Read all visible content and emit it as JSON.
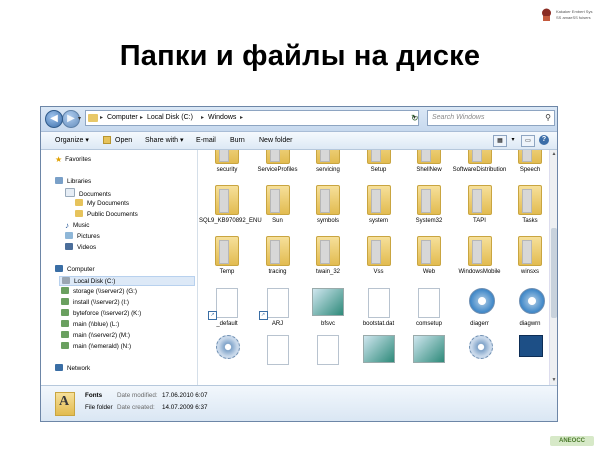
{
  "slide": {
    "title": "Папки и файлы на диске",
    "corner_logo": {
      "line1": "Kakaker Embert Sys",
      "line2": "SS amaeSS fuisers"
    },
    "bottom_logo": "ANEOCC"
  },
  "explorer": {
    "address": {
      "crumbs": [
        "Computer",
        "Local Disk (C:)",
        "Windows"
      ]
    },
    "search_placeholder": "Search Windows",
    "toolbar": {
      "organize": "Organize ▾",
      "open": "Open",
      "share": "Share with ▾",
      "email": "E-mail",
      "burn": "Burn",
      "new_folder": "New folder"
    },
    "nav": {
      "favorites": "Favorites",
      "libraries": "Libraries",
      "lib_items": [
        "Documents",
        "My Documents",
        "Public Documents",
        "Music",
        "Pictures",
        "Videos"
      ],
      "computer": "Computer",
      "drives": [
        "Local Disk (C:)",
        "storage (\\\\server2) (G:)",
        "install (\\\\server2) (I:)",
        "byteforce (\\\\server2) (K:)",
        "main (\\\\blue) (L:)",
        "main (\\\\server2) (M:)",
        "main (\\\\emerald) (N:)"
      ],
      "network": "Network"
    },
    "items": [
      {
        "label": "security",
        "kind": "folder"
      },
      {
        "label": "ServiceProfiles",
        "kind": "folder"
      },
      {
        "label": "servicing",
        "kind": "folder"
      },
      {
        "label": "Setup",
        "kind": "folder"
      },
      {
        "label": "ShellNew",
        "kind": "folder"
      },
      {
        "label": "SoftwareDistribution",
        "kind": "folder"
      },
      {
        "label": "Speech",
        "kind": "folder"
      },
      {
        "label": "SQL9_KB970892_ENU",
        "kind": "folder"
      },
      {
        "label": "Sun",
        "kind": "folder"
      },
      {
        "label": "symbols",
        "kind": "folder"
      },
      {
        "label": "system",
        "kind": "folder"
      },
      {
        "label": "System32",
        "kind": "folder"
      },
      {
        "label": "TAPI",
        "kind": "folder"
      },
      {
        "label": "Tasks",
        "kind": "folder"
      },
      {
        "label": "Temp",
        "kind": "folder"
      },
      {
        "label": "tracing",
        "kind": "folder"
      },
      {
        "label": "twain_32",
        "kind": "folder"
      },
      {
        "label": "Vss",
        "kind": "folder"
      },
      {
        "label": "Web",
        "kind": "folder"
      },
      {
        "label": "WindowsMobile",
        "kind": "folder"
      },
      {
        "label": "winsxs",
        "kind": "folder"
      },
      {
        "label": "_default",
        "kind": "file-shortcut"
      },
      {
        "label": "ARJ",
        "kind": "file-shortcut"
      },
      {
        "label": "bfsvc",
        "kind": "thumb"
      },
      {
        "label": "bootstat.dat",
        "kind": "file"
      },
      {
        "label": "comsetup",
        "kind": "file"
      },
      {
        "label": "diagerr",
        "kind": "disc"
      },
      {
        "label": "diagwrn",
        "kind": "disc"
      },
      {
        "label": "",
        "kind": "gear"
      },
      {
        "label": "",
        "kind": "file"
      },
      {
        "label": "",
        "kind": "file"
      },
      {
        "label": "",
        "kind": "thumb"
      },
      {
        "label": "",
        "kind": "thumb"
      },
      {
        "label": "",
        "kind": "gear"
      },
      {
        "label": "",
        "kind": "pc"
      }
    ],
    "details": {
      "name": "Fonts",
      "type": "File folder",
      "modified_label": "Date modified:",
      "modified_value": "17.06.2010 6:07",
      "created_label": "Date created:",
      "created_value": "14.07.2009 6:37"
    }
  }
}
